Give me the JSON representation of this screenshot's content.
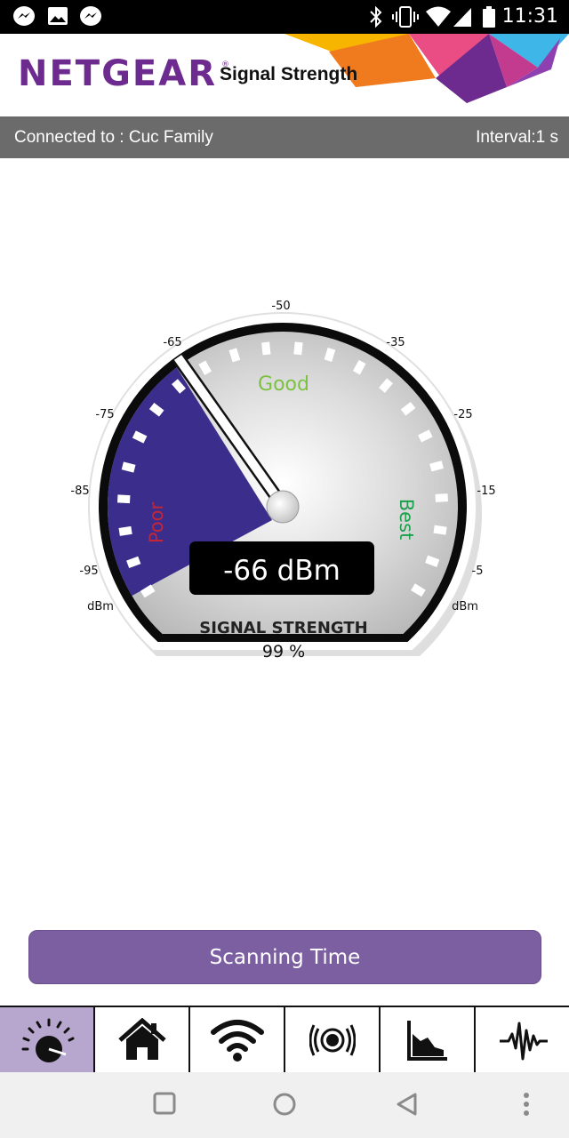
{
  "status_bar": {
    "time": "11:31",
    "left_icons": [
      "messenger-icon",
      "image-icon",
      "messenger-icon"
    ],
    "right_icons": [
      "bluetooth-icon",
      "vibrate-icon",
      "wifi-icon",
      "cell-signal-icon",
      "battery-icon"
    ]
  },
  "header": {
    "brand": "NETGEAR",
    "brand_mark": "®",
    "title": "Signal Strength",
    "accent_colors": [
      "#f7b500",
      "#ea4d83",
      "#6d2b8f",
      "#3fb6e8",
      "#f07b1f"
    ]
  },
  "connection": {
    "connected_label": "Connected to : Cuc Family",
    "interval_label": "Interval:1 s"
  },
  "gauge": {
    "scale_labels": [
      "-95",
      "-85",
      "-75",
      "-65",
      "-50",
      "-35",
      "-25",
      "-15",
      "-5"
    ],
    "unit_left": "dBm",
    "unit_right": "dBm",
    "zone_poor": "Poor",
    "zone_good": "Good",
    "zone_best": "Best",
    "reading": "-66 dBm",
    "reading_value_dbm": -66,
    "caption": "SIGNAL STRENGTH",
    "percent": "99 %",
    "colors": {
      "poor_fill": "#3a2d8c",
      "poor_text": "#c0273b",
      "good_text": "#7cc142",
      "best_text": "#1aa04a"
    }
  },
  "scan_button": {
    "label": "Scanning Time"
  },
  "tabs": [
    {
      "icon": "speedometer-icon",
      "active": true
    },
    {
      "icon": "home-icon",
      "active": false
    },
    {
      "icon": "wifi-icon",
      "active": false
    },
    {
      "icon": "radar-icon",
      "active": false
    },
    {
      "icon": "area-chart-icon",
      "active": false
    },
    {
      "icon": "waveform-icon",
      "active": false
    }
  ],
  "nav": {
    "icons": [
      "recents-icon",
      "home-circle-icon",
      "back-icon",
      "menu-dots-icon"
    ]
  }
}
